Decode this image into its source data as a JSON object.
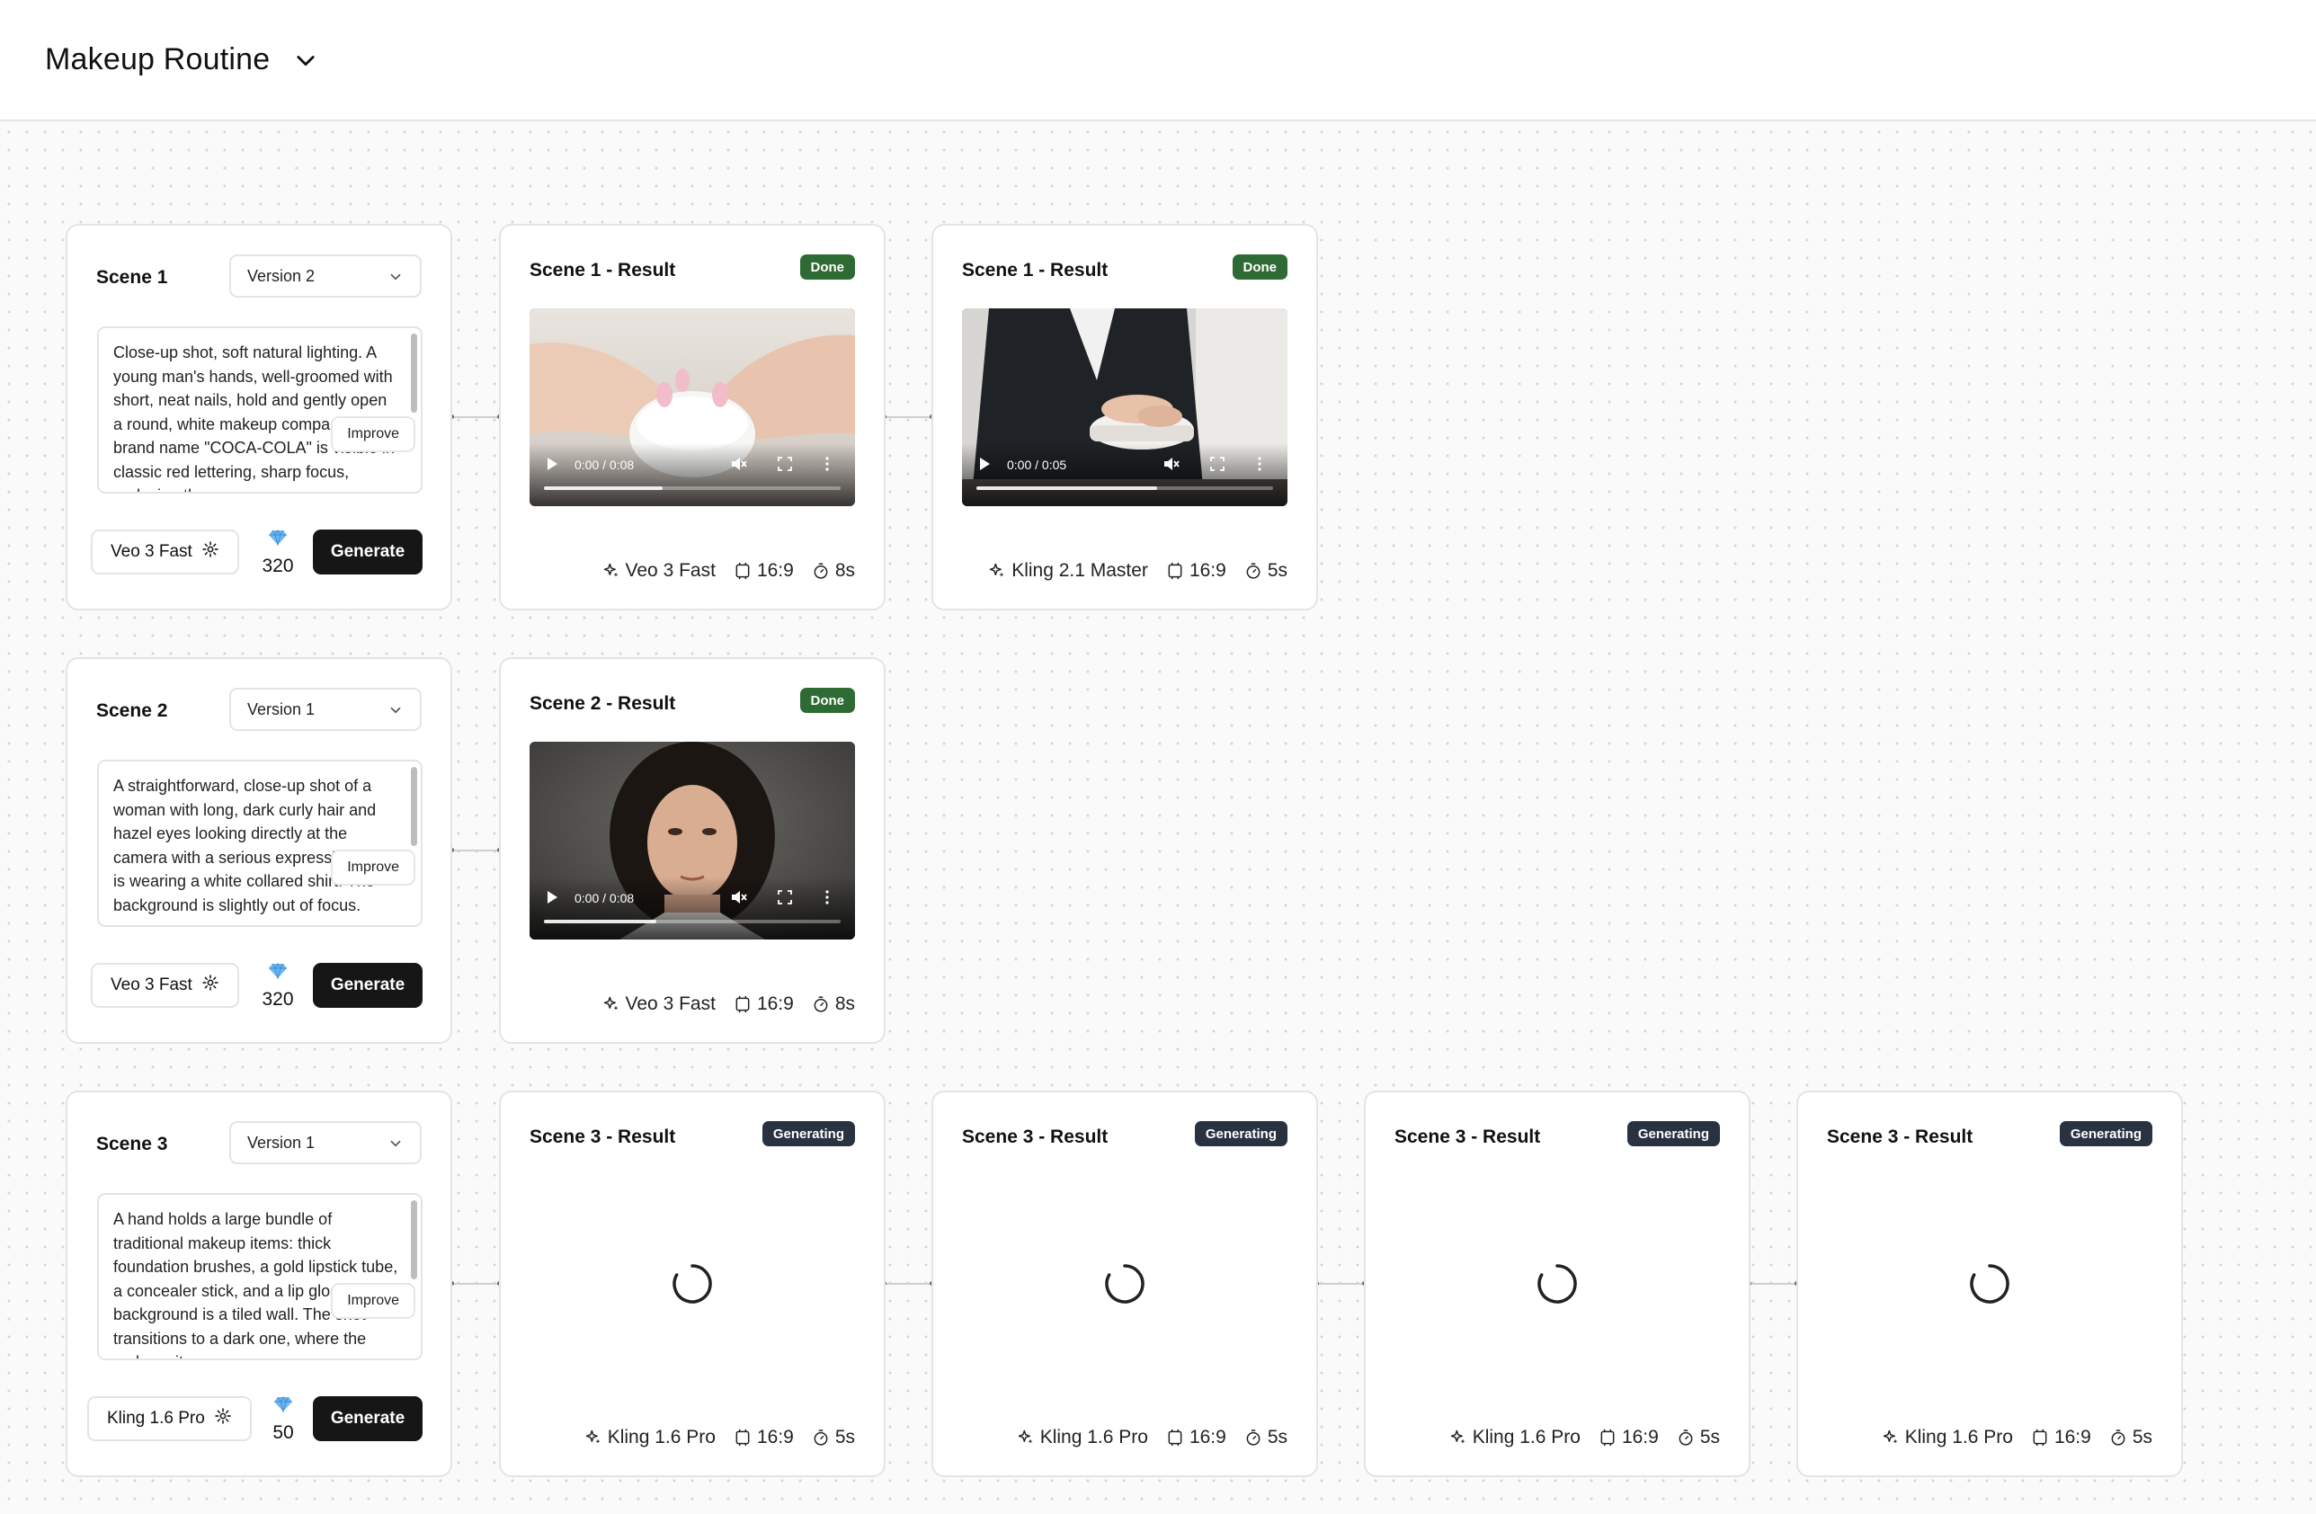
{
  "project": {
    "title": "Makeup Routine"
  },
  "scenes": [
    {
      "title": "Scene 1",
      "version": "Version 2",
      "prompt": "Close-up shot, soft natural lighting. A young man's hands, well-groomed with short, neat nails, hold and gently open a round, white makeup compact. The brand name \"COCA-COLA\" is visible in classic red lettering, sharp focus, replacing the",
      "improve_label": "Improve",
      "model": "Veo 3 Fast",
      "credits": "320",
      "generate_label": "Generate"
    },
    {
      "title": "Scene 2",
      "version": "Version 1",
      "prompt": "A straightforward, close-up shot of a woman with long, dark curly hair and hazel eyes looking directly at the camera with a serious expression. She is wearing a white collared shirt. The background is slightly out of focus.",
      "improve_label": "Improve",
      "model": "Veo 3 Fast",
      "credits": "320",
      "generate_label": "Generate"
    },
    {
      "title": "Scene 3",
      "version": "Version 1",
      "prompt": "A hand holds a large bundle of traditional makeup items: thick foundation brushes, a gold lipstick tube, a concealer stick, and a lip gloss. The background is a tiled wall. The shot transitions to a dark one, where the makeup items are",
      "improve_label": "Improve",
      "model": "Kling 1.6 Pro",
      "credits": "50",
      "generate_label": "Generate"
    }
  ],
  "results": [
    {
      "title": "Scene 1 - Result",
      "status": "Done",
      "time": "0:00 / 0:08",
      "model": "Veo 3 Fast",
      "ratio": "16:9",
      "duration": "8s"
    },
    {
      "title": "Scene 1 - Result",
      "status": "Done",
      "time": "0:00 / 0:05",
      "model": "Kling 2.1 Master",
      "ratio": "16:9",
      "duration": "5s"
    },
    {
      "title": "Scene 2 - Result",
      "status": "Done",
      "time": "0:00 / 0:08",
      "model": "Veo 3 Fast",
      "ratio": "16:9",
      "duration": "8s"
    },
    {
      "title": "Scene 3 - Result",
      "status": "Generating",
      "model": "Kling 1.6 Pro",
      "ratio": "16:9",
      "duration": "5s"
    },
    {
      "title": "Scene 3 - Result",
      "status": "Generating",
      "model": "Kling 1.6 Pro",
      "ratio": "16:9",
      "duration": "5s"
    },
    {
      "title": "Scene 3 - Result",
      "status": "Generating",
      "model": "Kling 1.6 Pro",
      "ratio": "16:9",
      "duration": "5s"
    },
    {
      "title": "Scene 3 - Result",
      "status": "Generating",
      "model": "Kling 1.6 Pro",
      "ratio": "16:9",
      "duration": "5s"
    }
  ],
  "colors": {
    "done": "#2e6b34",
    "generating": "#283241",
    "primary": "#161616"
  }
}
